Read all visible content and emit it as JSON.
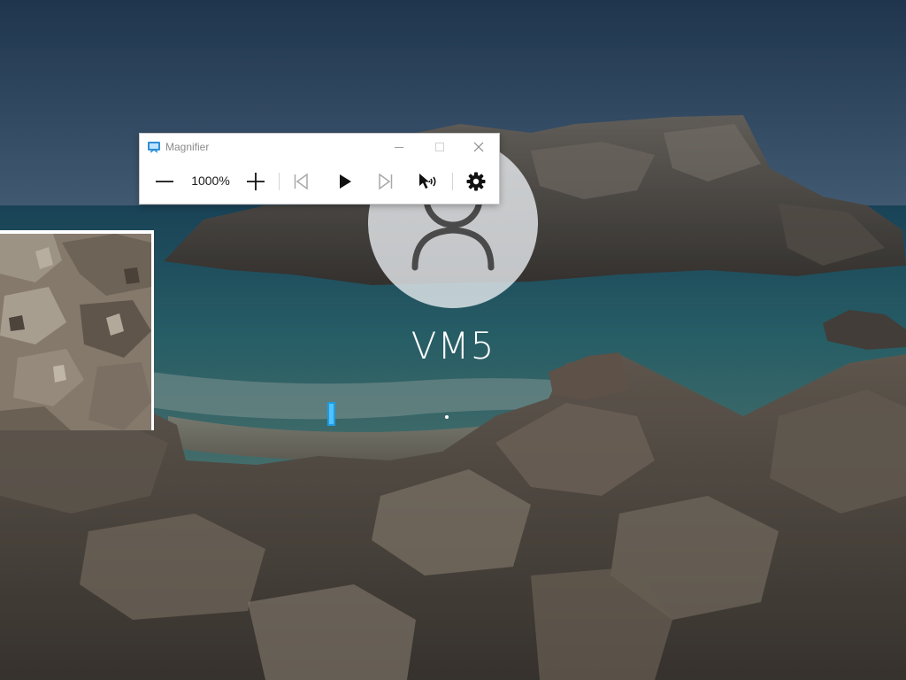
{
  "user": {
    "name": "VM5"
  },
  "magnifier": {
    "title": "Magnifier",
    "zoom_level": "1000%",
    "controls": {
      "zoom_out": "zoom-out-icon",
      "zoom_in": "zoom-in-icon",
      "previous": "previous-icon",
      "play": "play-icon",
      "next": "next-icon",
      "read_from_here": "read-from-here-icon",
      "settings": "gear-icon"
    },
    "window_buttons": [
      "minimize",
      "maximize",
      "close"
    ]
  },
  "colors": {
    "caret": "#1e9be0",
    "disabled_icon": "#a8a8a8",
    "icon": "#111111"
  }
}
